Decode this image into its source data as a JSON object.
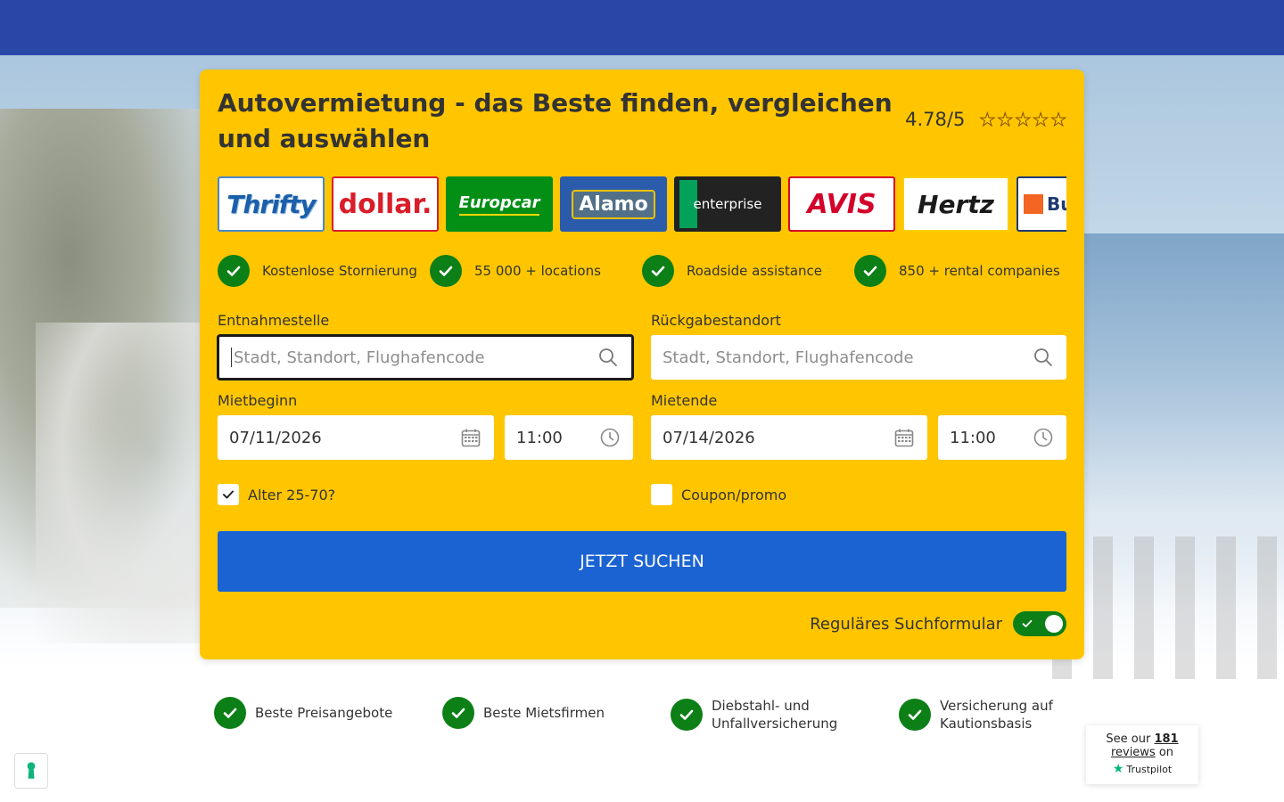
{
  "header": {
    "color": "#2847a7"
  },
  "search_card": {
    "title": "Autovermietung - das Beste finden, vergleichen und auswählen",
    "rating": {
      "value": "4.78/5",
      "stars": 5
    },
    "brands": [
      {
        "name": "Thrifty"
      },
      {
        "name": "dollar."
      },
      {
        "name": "Europcar"
      },
      {
        "name": "Alamo"
      },
      {
        "name": "enterprise"
      },
      {
        "name": "AVIS"
      },
      {
        "name": "Hertz"
      },
      {
        "name": "Bu"
      }
    ],
    "features": [
      "Kostenlose Stornierung",
      "55 000 + locations",
      "Roadside assistance",
      "850 + rental companies"
    ],
    "pickup": {
      "label": "Entnahmestelle",
      "placeholder": "Stadt, Standort, Flughafencode"
    },
    "dropoff": {
      "label": "Rückgabestandort",
      "placeholder": "Stadt, Standort, Flughafencode"
    },
    "start": {
      "label": "Mietbeginn",
      "date": "07/11/2026",
      "time": "11:00"
    },
    "end": {
      "label": "Mietende",
      "date": "07/14/2026",
      "time": "11:00"
    },
    "age_checkbox": {
      "label": "Alter 25-70?",
      "checked": true
    },
    "coupon_checkbox": {
      "label": "Coupon/promo",
      "checked": false
    },
    "search_button": "JETZT SUCHEN",
    "toggle": {
      "label": "Reguläres Suchformular",
      "on": true
    },
    "accent_color": "#ffc600",
    "button_color": "#1b63d2",
    "check_color": "#0c7f16"
  },
  "bottom_features": [
    {
      "line1": "Beste Preisangebote",
      "line2": ""
    },
    {
      "line1": "Beste Mietsfirmen",
      "line2": ""
    },
    {
      "line1": "Diebstahl- und",
      "line2": "Unfallversicherung"
    },
    {
      "line1": "Versicherung auf",
      "line2": "Kautionsbasis"
    }
  ],
  "trustpilot": {
    "prefix": "See our",
    "count": "181",
    "reviews": "reviews",
    "suffix": "on",
    "brand": "Trustpilot"
  }
}
